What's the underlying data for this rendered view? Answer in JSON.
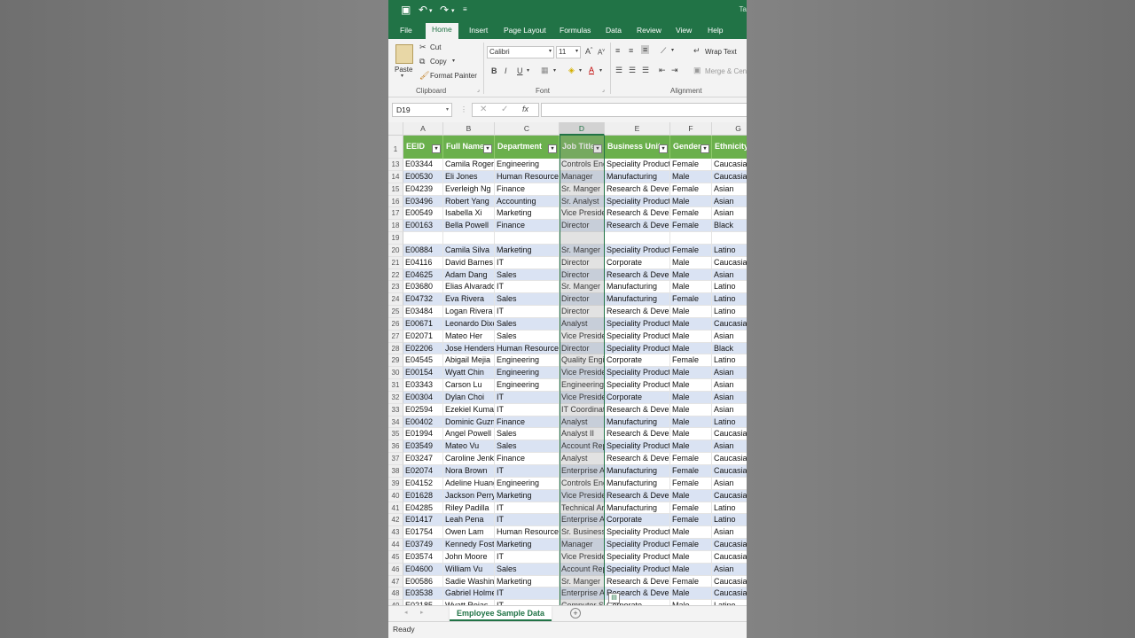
{
  "window": {
    "title_fragment": "Ta"
  },
  "tabs": [
    "File",
    "Home",
    "Insert",
    "Page Layout",
    "Formulas",
    "Data",
    "Review",
    "View",
    "Help"
  ],
  "active_tab": "Home",
  "ribbon": {
    "paste": "Paste",
    "cut": "Cut",
    "copy": "Copy",
    "format_painter": "Format Painter",
    "clipboard_label": "Clipboard",
    "font_name": "Calibri",
    "font_size": "11",
    "font_label": "Font",
    "wrap_text": "Wrap Text",
    "merge_center": "Merge & Cen",
    "alignment_label": "Alignment"
  },
  "formula_bar": {
    "name_box": "D19",
    "fx": "fx",
    "value": ""
  },
  "columns": [
    "A",
    "B",
    "C",
    "D",
    "E",
    "F",
    "G"
  ],
  "headers": [
    "EEID",
    "Full Name",
    "Department",
    "Job Title",
    "Business Unit",
    "Gender",
    "Ethnicity"
  ],
  "rows": [
    {
      "n": "13",
      "c": [
        "E03344",
        "Camila Rogers",
        "Engineering",
        "Controls Engineer",
        "Speciality Products",
        "Female",
        "Caucasian"
      ]
    },
    {
      "n": "14",
      "c": [
        "E00530",
        "Eli Jones",
        "Human Resources",
        "Manager",
        "Manufacturing",
        "Male",
        "Caucasian"
      ]
    },
    {
      "n": "15",
      "c": [
        "E04239",
        "Everleigh Ng",
        "Finance",
        "Sr. Manger",
        "Research & Development",
        "Female",
        "Asian"
      ]
    },
    {
      "n": "16",
      "c": [
        "E03496",
        "Robert Yang",
        "Accounting",
        "Sr. Analyst",
        "Speciality Products",
        "Male",
        "Asian"
      ]
    },
    {
      "n": "17",
      "c": [
        "E00549",
        "Isabella Xi",
        "Marketing",
        "Vice President",
        "Research & Development",
        "Female",
        "Asian"
      ]
    },
    {
      "n": "18",
      "c": [
        "E00163",
        "Bella Powell",
        "Finance",
        "Director",
        "Research & Development",
        "Female",
        "Black"
      ]
    },
    {
      "n": "19",
      "c": [
        "",
        "",
        "",
        "",
        "",
        "",
        ""
      ]
    },
    {
      "n": "20",
      "c": [
        "E00884",
        "Camila Silva",
        "Marketing",
        "Sr. Manger",
        "Speciality Products",
        "Female",
        "Latino"
      ]
    },
    {
      "n": "21",
      "c": [
        "E04116",
        "David Barnes",
        "IT",
        "Director",
        "Corporate",
        "Male",
        "Caucasian"
      ]
    },
    {
      "n": "22",
      "c": [
        "E04625",
        "Adam Dang",
        "Sales",
        "Director",
        "Research & Development",
        "Male",
        "Asian"
      ]
    },
    {
      "n": "23",
      "c": [
        "E03680",
        "Elias Alvarado",
        "IT",
        "Sr. Manger",
        "Manufacturing",
        "Male",
        "Latino"
      ]
    },
    {
      "n": "24",
      "c": [
        "E04732",
        "Eva Rivera",
        "Sales",
        "Director",
        "Manufacturing",
        "Female",
        "Latino"
      ]
    },
    {
      "n": "25",
      "c": [
        "E03484",
        "Logan Rivera",
        "IT",
        "Director",
        "Research & Development",
        "Male",
        "Latino"
      ]
    },
    {
      "n": "26",
      "c": [
        "E00671",
        "Leonardo Dixon",
        "Sales",
        "Analyst",
        "Speciality Products",
        "Male",
        "Caucasian"
      ]
    },
    {
      "n": "27",
      "c": [
        "E02071",
        "Mateo Her",
        "Sales",
        "Vice President",
        "Speciality Products",
        "Male",
        "Asian"
      ]
    },
    {
      "n": "28",
      "c": [
        "E02206",
        "Jose Henderson",
        "Human Resources",
        "Director",
        "Speciality Products",
        "Male",
        "Black"
      ]
    },
    {
      "n": "29",
      "c": [
        "E04545",
        "Abigail Mejia",
        "Engineering",
        "Quality Engineer",
        "Corporate",
        "Female",
        "Latino"
      ]
    },
    {
      "n": "30",
      "c": [
        "E00154",
        "Wyatt Chin",
        "Engineering",
        "Vice President",
        "Speciality Products",
        "Male",
        "Asian"
      ]
    },
    {
      "n": "31",
      "c": [
        "E03343",
        "Carson Lu",
        "Engineering",
        "Engineering Manager",
        "Speciality Products",
        "Male",
        "Asian"
      ]
    },
    {
      "n": "32",
      "c": [
        "E00304",
        "Dylan Choi",
        "IT",
        "Vice President",
        "Corporate",
        "Male",
        "Asian"
      ]
    },
    {
      "n": "33",
      "c": [
        "E02594",
        "Ezekiel Kumar",
        "IT",
        "IT Coordinator",
        "Research & Development",
        "Male",
        "Asian"
      ]
    },
    {
      "n": "34",
      "c": [
        "E00402",
        "Dominic Guzman",
        "Finance",
        "Analyst",
        "Manufacturing",
        "Male",
        "Latino"
      ]
    },
    {
      "n": "35",
      "c": [
        "E01994",
        "Angel Powell",
        "Sales",
        "Analyst II",
        "Research & Development",
        "Male",
        "Caucasian"
      ]
    },
    {
      "n": "36",
      "c": [
        "E03549",
        "Mateo Vu",
        "Sales",
        "Account Representative",
        "Speciality Products",
        "Male",
        "Asian"
      ]
    },
    {
      "n": "37",
      "c": [
        "E03247",
        "Caroline Jenkins",
        "Finance",
        "Analyst",
        "Research & Development",
        "Female",
        "Caucasian"
      ]
    },
    {
      "n": "38",
      "c": [
        "E02074",
        "Nora Brown",
        "IT",
        "Enterprise Architect",
        "Manufacturing",
        "Female",
        "Caucasian"
      ]
    },
    {
      "n": "39",
      "c": [
        "E04152",
        "Adeline Huang",
        "Engineering",
        "Controls Engineer",
        "Manufacturing",
        "Female",
        "Asian"
      ]
    },
    {
      "n": "40",
      "c": [
        "E01628",
        "Jackson Perry",
        "Marketing",
        "Vice President",
        "Research & Development",
        "Male",
        "Caucasian"
      ]
    },
    {
      "n": "41",
      "c": [
        "E04285",
        "Riley Padilla",
        "IT",
        "Technical Architect",
        "Manufacturing",
        "Female",
        "Latino"
      ]
    },
    {
      "n": "42",
      "c": [
        "E01417",
        "Leah Pena",
        "IT",
        "Enterprise Architect",
        "Corporate",
        "Female",
        "Latino"
      ]
    },
    {
      "n": "43",
      "c": [
        "E01754",
        "Owen Lam",
        "Human Resources",
        "Sr. Business Partner",
        "Speciality Products",
        "Male",
        "Asian"
      ]
    },
    {
      "n": "44",
      "c": [
        "E03749",
        "Kennedy Foster",
        "Marketing",
        "Manager",
        "Speciality Products",
        "Female",
        "Caucasian"
      ]
    },
    {
      "n": "45",
      "c": [
        "E03574",
        "John Moore",
        "IT",
        "Vice President",
        "Speciality Products",
        "Male",
        "Caucasian"
      ]
    },
    {
      "n": "46",
      "c": [
        "E04600",
        "William Vu",
        "Sales",
        "Account Representative",
        "Speciality Products",
        "Male",
        "Asian"
      ]
    },
    {
      "n": "47",
      "c": [
        "E00586",
        "Sadie Washington",
        "Marketing",
        "Sr. Manger",
        "Research & Development",
        "Female",
        "Caucasian"
      ]
    },
    {
      "n": "48",
      "c": [
        "E03538",
        "Gabriel Holmes",
        "IT",
        "Enterprise Architect",
        "Research & Development",
        "Male",
        "Caucasian"
      ]
    },
    {
      "n": "49",
      "c": [
        "E02185",
        "Wyatt Rojas",
        "IT",
        "Computer Systems Manager",
        "Corporate",
        "Male",
        "Latino"
      ]
    }
  ],
  "sheet_tab": "Employee Sample Data",
  "status": "Ready",
  "colors": {
    "excel_green": "#217346",
    "header_green": "#6ab04c",
    "band_blue": "#dae3f3"
  }
}
